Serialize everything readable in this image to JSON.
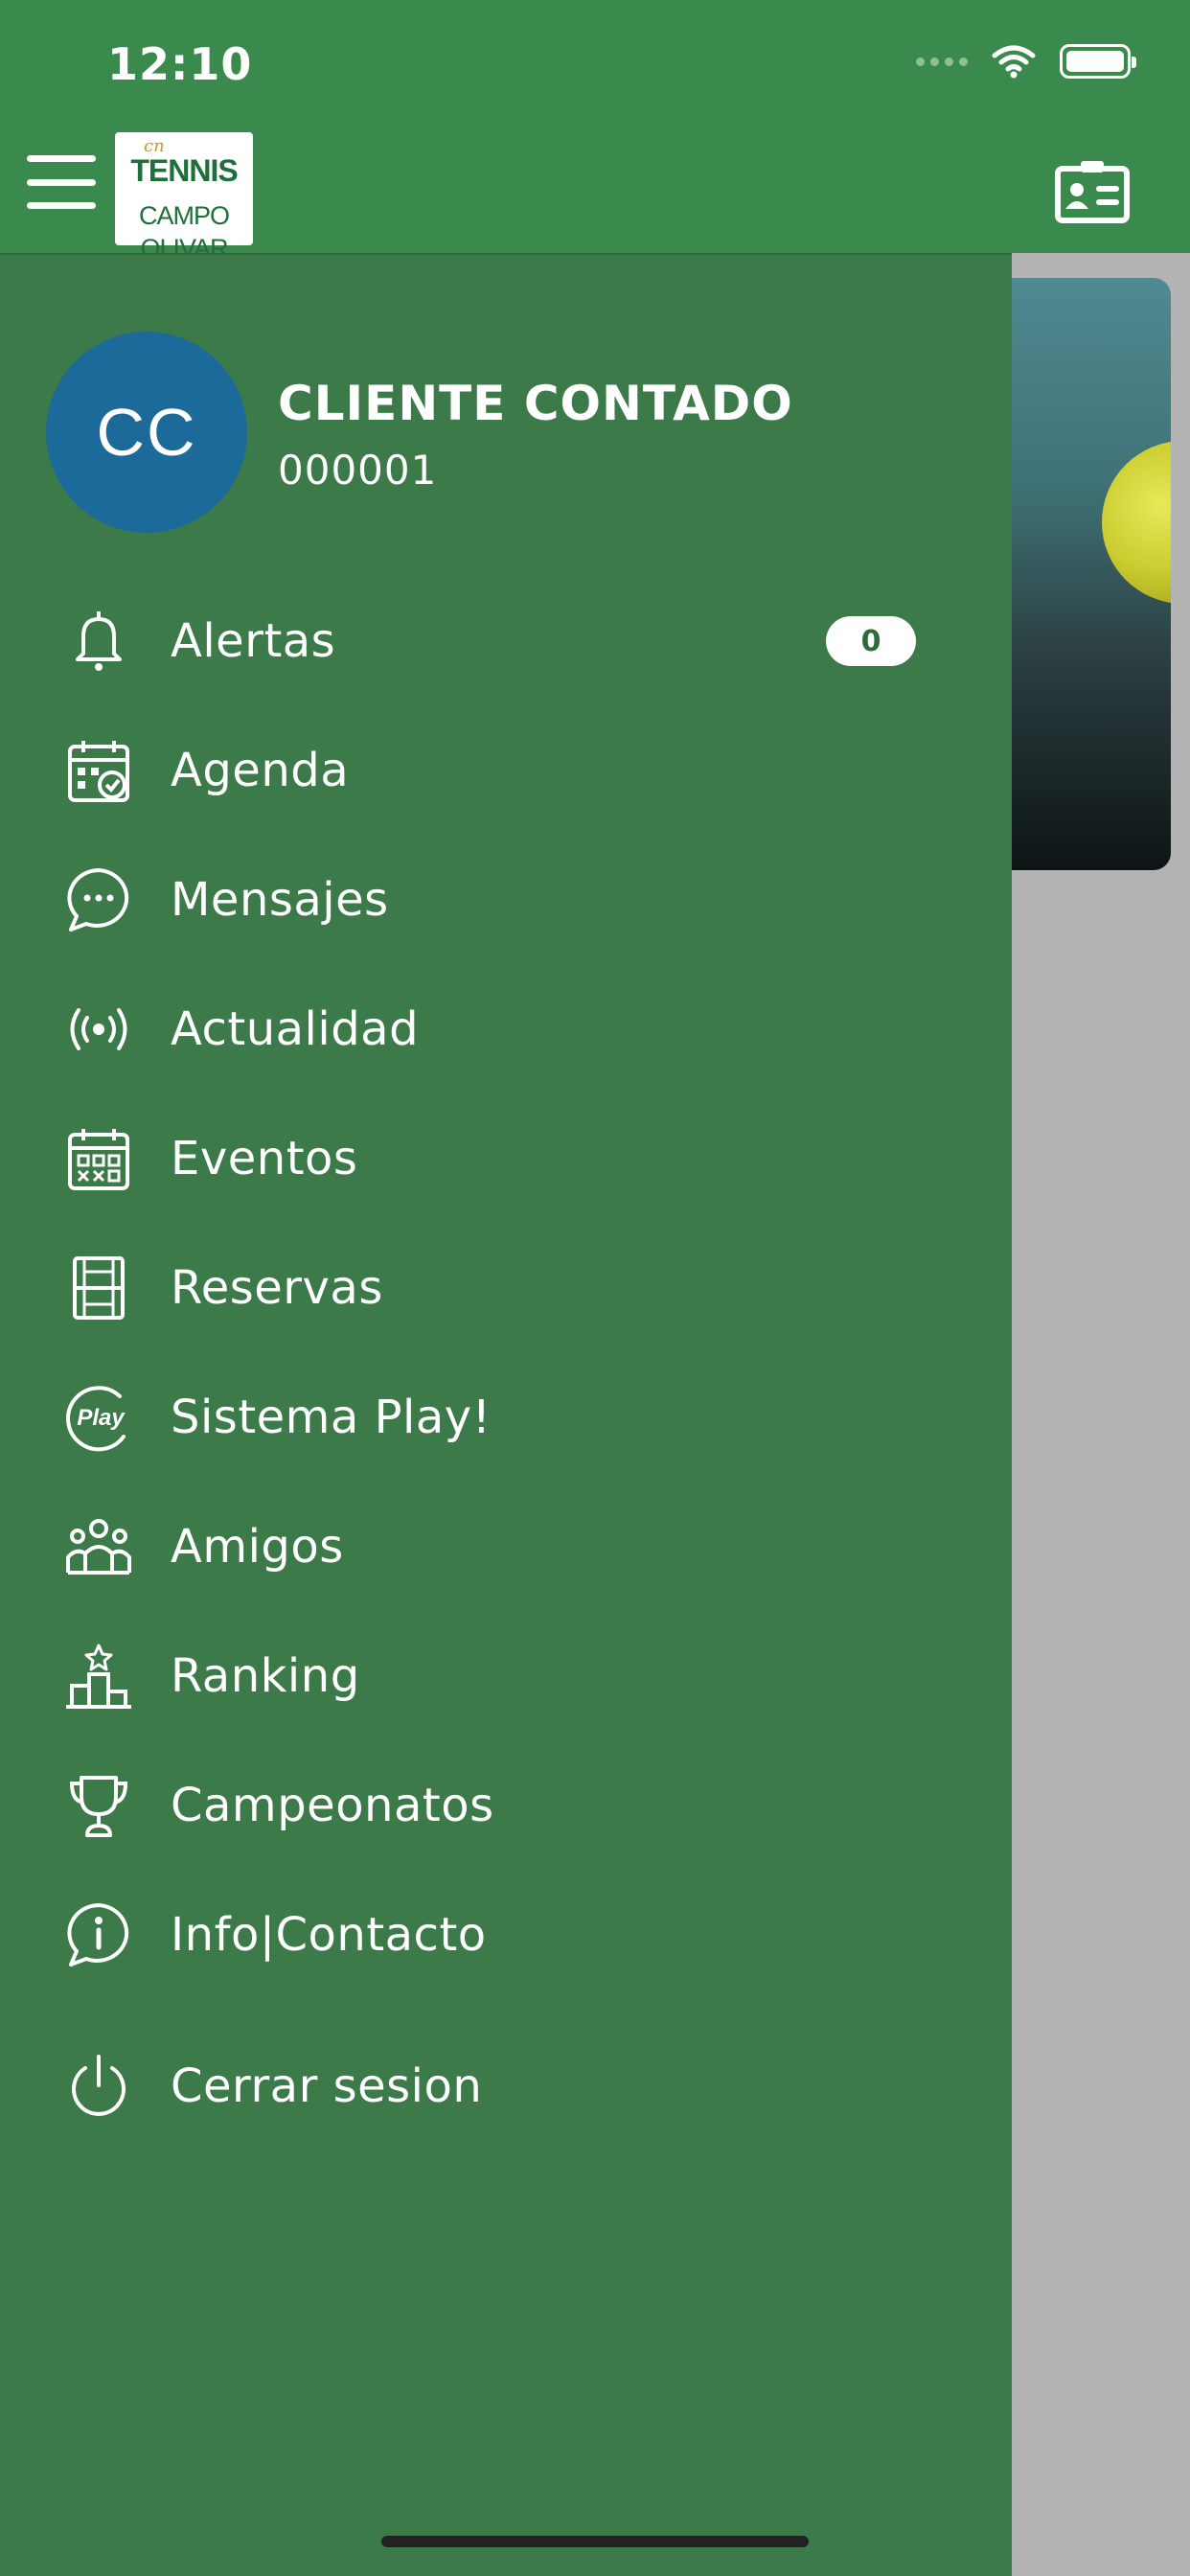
{
  "status_bar": {
    "time": "12:10"
  },
  "header": {
    "logo": {
      "line1": "cn",
      "line2": "TENNIS",
      "line3": "CAMPO OLIVAR"
    }
  },
  "user": {
    "initials": "CC",
    "name": "CLIENTE CONTADO",
    "id": "000001"
  },
  "menu": {
    "items": [
      {
        "label": "Alertas",
        "icon": "bell-icon",
        "badge": "0"
      },
      {
        "label": "Agenda",
        "icon": "calendar-check-icon"
      },
      {
        "label": "Mensajes",
        "icon": "chat-bubble-icon"
      },
      {
        "label": "Actualidad",
        "icon": "broadcast-icon"
      },
      {
        "label": "Eventos",
        "icon": "calendar-grid-icon"
      },
      {
        "label": "Reservas",
        "icon": "court-icon"
      },
      {
        "label": "Sistema Play!",
        "icon": "play-logo-icon"
      },
      {
        "label": "Amigos",
        "icon": "group-icon"
      },
      {
        "label": "Ranking",
        "icon": "podium-icon"
      },
      {
        "label": "Campeonatos",
        "icon": "trophy-icon"
      },
      {
        "label": "Info|Contacto",
        "icon": "info-chat-icon"
      },
      {
        "label": "Cerrar sesion",
        "icon": "power-icon"
      }
    ]
  },
  "colors": {
    "header": "#3b8a4d",
    "drawer": "#3d7a4a",
    "avatar": "#1c6a9a",
    "badge_text": "#2e6b3b"
  }
}
